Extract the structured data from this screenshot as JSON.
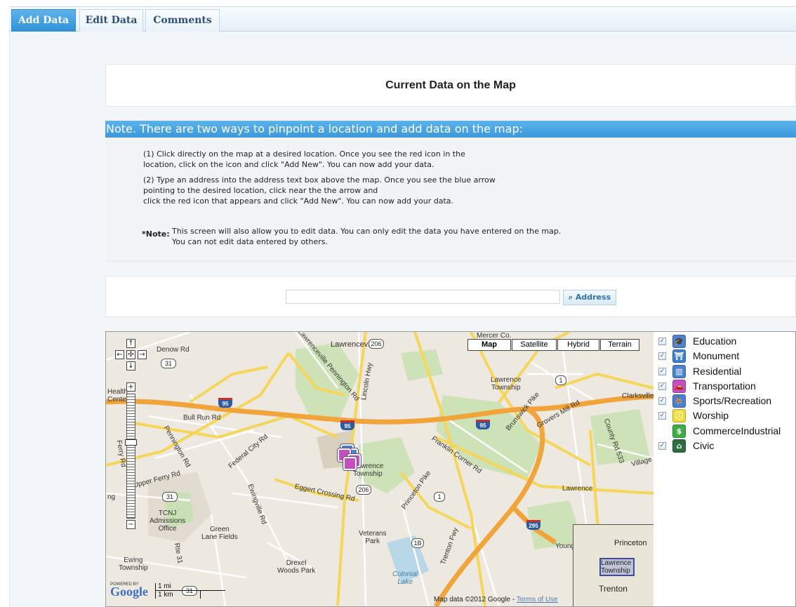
{
  "tabs": [
    {
      "label": "Add Data",
      "active": true
    },
    {
      "label": "Edit Data",
      "active": false
    },
    {
      "label": "Comments",
      "active": false
    }
  ],
  "page_title": "Current Data on the Map",
  "note": {
    "heading": "Note. There are two ways to pinpoint a location and add data on the map:",
    "step1": "(1) Click directly on the map at a desired location. Once you see the red icon in the\nlocation, click on the icon and click \"Add New\". You can now add your data.",
    "step2": "(2) Type an address into the address text box above the map. Once you see the blue arrow\npointing to the desired location, click near the the arrow and\nclick the red icon that appears and click \"Add New\". You can now add your data.",
    "label": "*Note:",
    "text": "This screen will also allow you to edit data. You can only edit the data you have entered on the map.\nYou can not edit data entered by others."
  },
  "address": {
    "value": "",
    "button_label": "Address",
    "button_icon": "search-icon"
  },
  "map": {
    "map_types": [
      {
        "label": "Map",
        "active": true
      },
      {
        "label": "Satellite",
        "active": false
      },
      {
        "label": "Hybrid",
        "active": false
      },
      {
        "label": "Terrain",
        "active": false
      }
    ],
    "labels": {
      "lawrenceville": "Lawrenceville",
      "lawrence_township_ne": "Lawrence\nTownship",
      "lawrence_township_c": "Lawrence\nTownship",
      "lawrence": "Lawrence",
      "clarksville": "Clarksville",
      "denow_rd": "Denow Rd",
      "bull_run_rd": "Bull Run Rd",
      "federal_city_rd": "Federal City Rd",
      "pennington_rd": "Pennington Rd",
      "upper_ferry_rd": "Upper Ferry Rd",
      "eggert_crossing_rd": "Eggert Crossing Rd",
      "ewingville_rd": "Ewingville Rd",
      "franklin_corner_rd": "Franklin Corner Rd",
      "princeton_pike": "Princeton Pike",
      "brunswick_pike": "Brunswick Pike",
      "groverss_mill_rd": "Grovers Mill Rd",
      "county_rd_533": "County Rd 533",
      "village_rd": "Village Re",
      "lincoln_hwy": "Lincoln Hwy",
      "lawrenceville_pennington_rd": "Lawrenceville Pennington Rd",
      "tcnj": "TCNJ\nAdmissions\nOffice",
      "green_lane_fields": "Green\nLane Fields",
      "veterans_park": "Veterans\nPark",
      "drexel_woods_park": "Drexel\nWoods Park",
      "colonial_lake": "Colonial\nLake",
      "ewing_township": "Ewing\nTownship",
      "health_center": "Health\nCenter",
      "mercer_co": "Mercer Co.",
      "trenton_fwy": "Trenton Fwy",
      "rte_31": "Rte 31",
      "young": "Young",
      "ng": "ng",
      "ferry_rd": "Ferry Rd"
    },
    "shields": {
      "us206_top": "206",
      "us206_mid": "206",
      "rt31_top": "31",
      "rt31_mid": "31",
      "rt31_bot": "31",
      "i95_w": "95",
      "i95_c": "95",
      "i95_e": "95",
      "i295": "295",
      "rt1_n": "1",
      "rt1_s": "1",
      "rt1b": "1B"
    },
    "controls": {
      "pan_up": "↑",
      "pan_left": "←",
      "pan_center": "✣",
      "pan_right": "→",
      "pan_down": "↓",
      "zoom_in": "+",
      "zoom_out": "−",
      "zoom_level_fraction": 0.38
    },
    "logo_powered": "POWERED BY",
    "logo": "Google",
    "scale_mi": "1 mi",
    "scale_km": "1 km",
    "attribution": "Map data ©2012 Google -",
    "terms": "Terms of Use",
    "overview_labels": {
      "princeton": "Princeton",
      "lawrence_township": "Lawrence\nTownship",
      "trenton": "Trenton"
    }
  },
  "legend": [
    {
      "label": "Education",
      "checked": true,
      "icon": "education-icon",
      "color": "#4f83cf",
      "glyph": "🎓"
    },
    {
      "label": "Monument",
      "checked": true,
      "icon": "monument-icon",
      "color": "#3f7fd0",
      "glyph": "⛩"
    },
    {
      "label": "Residential",
      "checked": true,
      "icon": "residential-icon",
      "color": "#4a82cf",
      "glyph": "▥"
    },
    {
      "label": "Transportation",
      "checked": true,
      "icon": "transportation-icon",
      "color": "#c64fc0",
      "glyph": "🚗"
    },
    {
      "label": "Sports/Recreation",
      "checked": true,
      "icon": "sports-recreation-icon",
      "color": "#4a7fd6",
      "glyph": "⛹"
    },
    {
      "label": "Worship",
      "checked": true,
      "icon": "worship-icon",
      "color": "#f2dd3a",
      "glyph": "ⓘ"
    },
    {
      "label": "CommerceIndustrial",
      "checked": false,
      "icon": "commerce-industrial-icon",
      "color": "#3fae47",
      "glyph": "$"
    },
    {
      "label": "Civic",
      "checked": true,
      "icon": "civic-icon",
      "color": "#2d6e3e",
      "glyph": "⌂"
    }
  ]
}
